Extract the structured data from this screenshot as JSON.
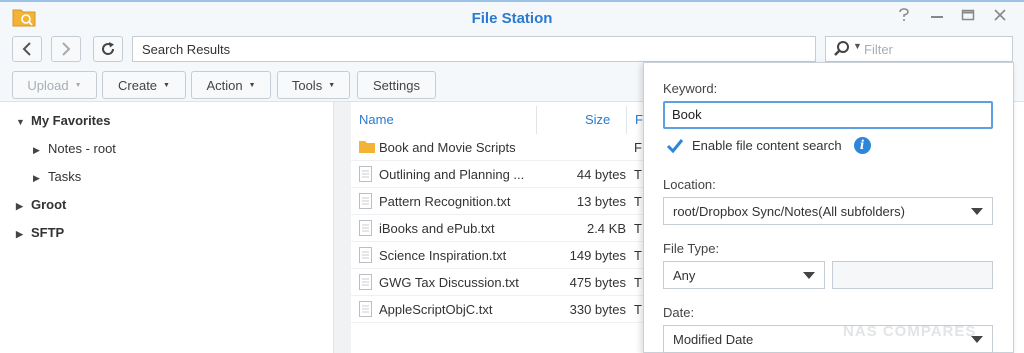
{
  "window": {
    "title": "File Station",
    "controls": [
      "help",
      "minimize",
      "maximize",
      "close"
    ]
  },
  "nav": {
    "path": "Search Results",
    "search_placeholder": "Filter"
  },
  "toolbar": {
    "upload": "Upload",
    "create": "Create",
    "action": "Action",
    "tools": "Tools",
    "settings": "Settings"
  },
  "sidebar": {
    "favorites": "My Favorites",
    "items": [
      "Notes - root",
      "Tasks"
    ],
    "groot": "Groot",
    "sftp": "SFTP"
  },
  "table": {
    "columns": {
      "name": "Name",
      "size": "Size",
      "type": "F"
    },
    "rows": [
      {
        "name": "Book and Movie Scripts",
        "size": "",
        "type": "F",
        "icon": "folder-icon"
      },
      {
        "name": "Outlining and Planning ...",
        "size": "44 bytes",
        "type": "T",
        "icon": "file-icon"
      },
      {
        "name": "Pattern Recognition.txt",
        "size": "13 bytes",
        "type": "T",
        "icon": "file-icon"
      },
      {
        "name": "iBooks and ePub.txt",
        "size": "2.4 KB",
        "type": "T",
        "icon": "file-icon"
      },
      {
        "name": "Science Inspiration.txt",
        "size": "149 bytes",
        "type": "T",
        "icon": "file-icon"
      },
      {
        "name": "GWG Tax Discussion.txt",
        "size": "475 bytes",
        "type": "T",
        "icon": "file-icon"
      },
      {
        "name": "AppleScriptObjC.txt",
        "size": "330 bytes",
        "type": "T",
        "icon": "file-icon"
      }
    ]
  },
  "search_panel": {
    "keyword_label": "Keyword:",
    "keyword_value": "Book",
    "content_search_label": "Enable file content search",
    "content_search_checked": true,
    "location_label": "Location:",
    "location_value": "root/Dropbox Sync/Notes(All subfolders)",
    "file_type_label": "File Type:",
    "file_type_value": "Any",
    "date_label": "Date:",
    "date_value": "Modified Date"
  },
  "watermark": "NAS COMPARES",
  "colors": {
    "accent": "#2a7ad0",
    "input_focus": "#5da0e2",
    "folder": "#f5b335"
  }
}
